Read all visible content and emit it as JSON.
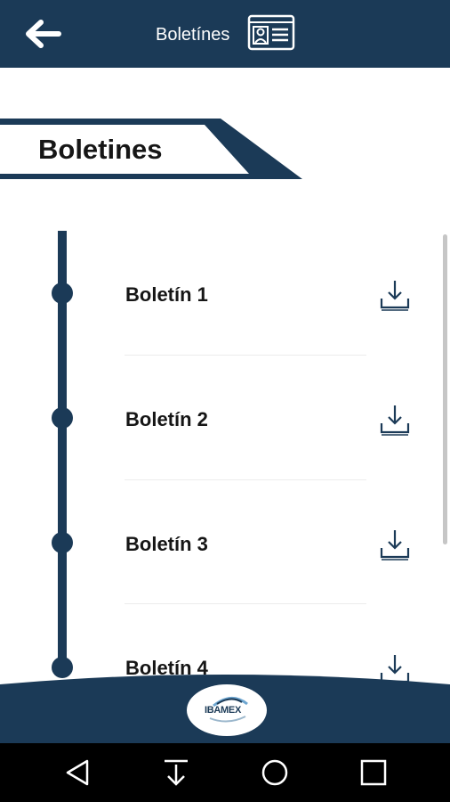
{
  "appbar": {
    "title": "Boletínes",
    "back_icon": "arrow-left-icon",
    "card_icon": "id-card-icon"
  },
  "section": {
    "title": "Boletines"
  },
  "items": [
    {
      "label": "Boletín 1",
      "icon": "download-icon"
    },
    {
      "label": "Boletín 2",
      "icon": "download-icon"
    },
    {
      "label": "Boletín 3",
      "icon": "download-icon"
    },
    {
      "label": "Boletín 4",
      "icon": "download-icon"
    }
  ],
  "footer": {
    "logo_text": "IBAMEX"
  },
  "navbar": {
    "icons": [
      "nav-back-icon",
      "nav-download-icon",
      "nav-home-icon",
      "nav-recents-icon"
    ]
  },
  "colors": {
    "primary": "#1b3a57",
    "text": "#161616",
    "background": "#ffffff"
  }
}
